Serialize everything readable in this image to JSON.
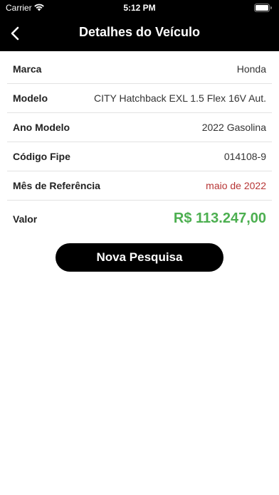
{
  "status_bar": {
    "carrier": "Carrier",
    "time": "5:12 PM"
  },
  "nav": {
    "title": "Detalhes do Veículo",
    "back_icon": "chevron-left-icon"
  },
  "details": [
    {
      "label": "Marca",
      "value": "Honda"
    },
    {
      "label": "Modelo",
      "value": "CITY Hatchback EXL 1.5 Flex 16V Aut."
    },
    {
      "label": "Ano Modelo",
      "value": "2022 Gasolina"
    },
    {
      "label": "Código Fipe",
      "value": "014108-9"
    },
    {
      "label": "Mês de Referência",
      "value": "maio de 2022"
    },
    {
      "label": "Valor",
      "value": "R$ 113.247,00"
    }
  ],
  "colors": {
    "header": "#000000",
    "reference": "#b73535",
    "price": "#4caf50",
    "button": "#000000"
  },
  "button": {
    "label": "Nova Pesquisa"
  }
}
